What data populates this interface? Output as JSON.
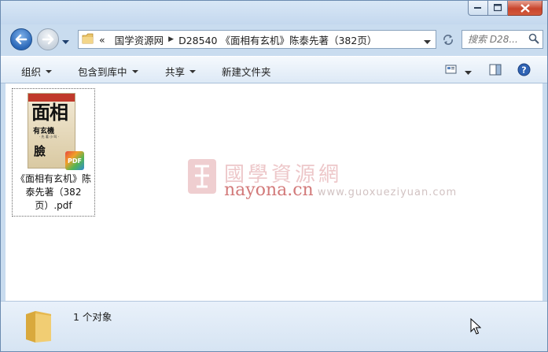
{
  "window": {
    "controls": [
      "minimize",
      "maximize",
      "close"
    ]
  },
  "nav": {
    "back_icon": "back-arrow-icon",
    "forward_icon": "forward-arrow-icon"
  },
  "address_bar": {
    "overflow": "«",
    "segments": [
      "国学资源网",
      "D28540 《面相有玄机》陈泰先著（382页）"
    ]
  },
  "search": {
    "placeholder": "搜索 D28..."
  },
  "toolbar": {
    "organize": "组织",
    "include_in_library": "包含到库中",
    "share": "共享",
    "new_folder": "新建文件夹"
  },
  "file": {
    "name": "《面相有玄机》陈泰先著（382页）.pdf",
    "type_badge": "PDF",
    "thumb_text": {
      "big": "面相",
      "mid": "有玄機",
      "small": "· 先 著 小 叫 ·",
      "bottom": "臉"
    }
  },
  "watermark": {
    "title": "國學資源網",
    "url_highlight": "nayona.cn",
    "url_rest": "www.guoxueziyuan.com"
  },
  "details": {
    "count_text": "1 个对象"
  },
  "colors": {
    "accent": "#2b68b8",
    "close": "#c8452c",
    "watermark": "#c8545a"
  }
}
